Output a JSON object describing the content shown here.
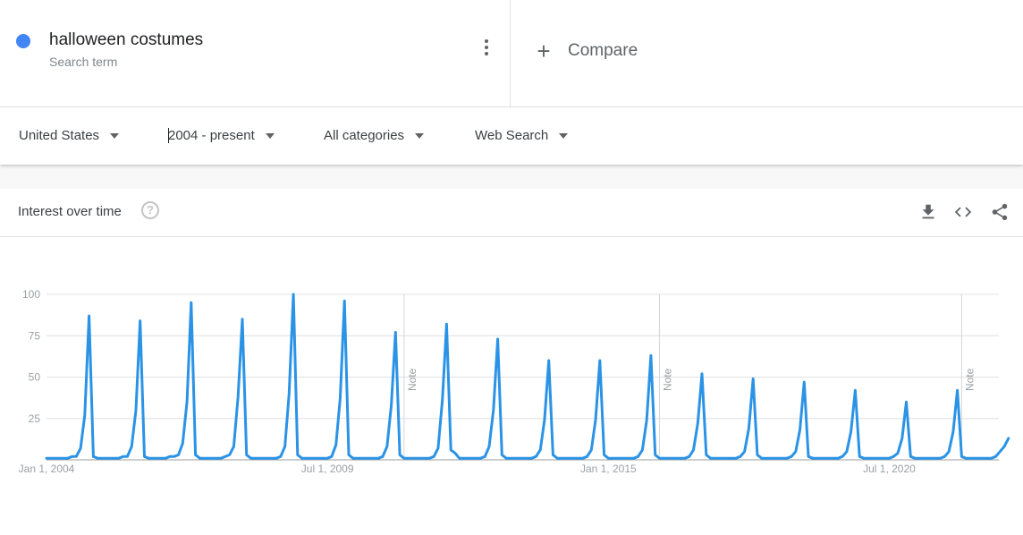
{
  "search_term": {
    "name": "halloween costumes",
    "type": "Search term",
    "color": "#4285f4",
    "menu_icon": "more-vert-icon"
  },
  "compare": {
    "label": "Compare",
    "icon": "plus-icon"
  },
  "filters": {
    "region": "United States",
    "time_range": "2004 - present",
    "category": "All categories",
    "property": "Web Search"
  },
  "card": {
    "title": "Interest over time",
    "help_icon": "help-circle-icon",
    "tools": [
      "download-icon",
      "embed-code-icon",
      "share-icon"
    ]
  },
  "chart_data": {
    "type": "line",
    "title": "Interest over time",
    "xlabel": "",
    "ylabel": "",
    "ylim": [
      0,
      100
    ],
    "yticks": [
      25,
      50,
      75,
      100
    ],
    "xtick_labels": [
      {
        "label": "Jan 1, 2004",
        "month_index": 0
      },
      {
        "label": "Jul 1, 2009",
        "month_index": 66
      },
      {
        "label": "Jan 1, 2015",
        "month_index": 132
      },
      {
        "label": "Jul 1, 2020",
        "month_index": 198
      }
    ],
    "grid": true,
    "start": "2004-01",
    "frequency": "monthly",
    "notes": [
      {
        "label": "Note",
        "month_index": 84
      },
      {
        "label": "Note",
        "month_index": 144
      },
      {
        "label": "Note",
        "month_index": 215
      }
    ],
    "series": [
      {
        "name": "halloween costumes",
        "color": "#2b93e6",
        "values": [
          1,
          1,
          1,
          1,
          1,
          1,
          2,
          2,
          7,
          27,
          87,
          2,
          1,
          1,
          1,
          1,
          1,
          1,
          2,
          2,
          8,
          30,
          84,
          2,
          1,
          1,
          1,
          1,
          1,
          2,
          2,
          3,
          10,
          35,
          95,
          3,
          1,
          1,
          1,
          1,
          1,
          1,
          2,
          3,
          8,
          38,
          85,
          3,
          1,
          1,
          1,
          1,
          1,
          1,
          1,
          2,
          8,
          40,
          100,
          3,
          1,
          1,
          1,
          1,
          1,
          1,
          1,
          2,
          9,
          37,
          96,
          3,
          1,
          1,
          1,
          1,
          1,
          1,
          1,
          2,
          8,
          33,
          77,
          3,
          1,
          1,
          1,
          1,
          1,
          1,
          1,
          2,
          7,
          36,
          82,
          6,
          4,
          1,
          1,
          1,
          1,
          1,
          1,
          2,
          8,
          30,
          73,
          3,
          1,
          1,
          1,
          1,
          1,
          1,
          1,
          2,
          6,
          24,
          60,
          3,
          1,
          1,
          1,
          1,
          1,
          1,
          1,
          2,
          6,
          24,
          60,
          3,
          1,
          1,
          1,
          1,
          1,
          1,
          1,
          2,
          6,
          24,
          63,
          3,
          1,
          1,
          1,
          1,
          1,
          1,
          1,
          2,
          6,
          22,
          52,
          3,
          1,
          1,
          1,
          1,
          1,
          1,
          1,
          2,
          5,
          19,
          49,
          3,
          1,
          1,
          1,
          1,
          1,
          1,
          1,
          2,
          5,
          18,
          47,
          2,
          1,
          1,
          1,
          1,
          1,
          1,
          1,
          2,
          5,
          17,
          42,
          2,
          1,
          1,
          1,
          1,
          1,
          1,
          1,
          2,
          4,
          13,
          35,
          2,
          1,
          1,
          1,
          1,
          1,
          1,
          1,
          2,
          5,
          17,
          42,
          2,
          1,
          1,
          1,
          1,
          1,
          1,
          1,
          2,
          5,
          8,
          13
        ]
      }
    ]
  }
}
